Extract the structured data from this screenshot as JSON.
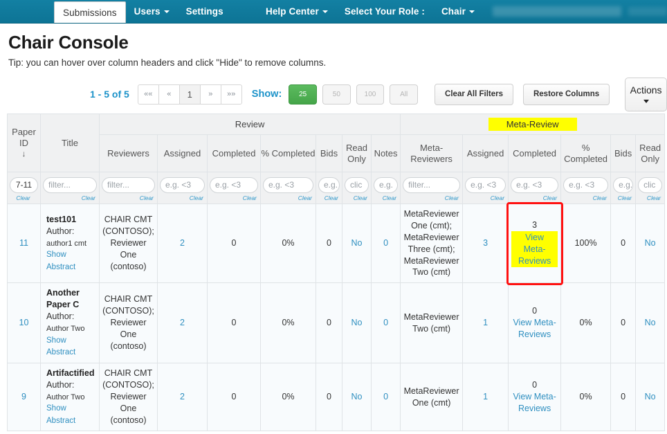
{
  "navbar": {
    "items": [
      {
        "label": "Submissions",
        "active": true,
        "caret": false
      },
      {
        "label": "Users",
        "active": false,
        "caret": true
      },
      {
        "label": "Settings",
        "active": false,
        "caret": false
      }
    ],
    "right_items": [
      {
        "label": "Help Center",
        "caret": true
      },
      {
        "label": "Select Your Role :",
        "caret": false
      },
      {
        "label": "Chair",
        "caret": true
      }
    ]
  },
  "page": {
    "title": "Chair Console",
    "tip": "Tip: you can hover over column headers and click \"Hide\" to remove columns."
  },
  "toolbar": {
    "result_count": "1 - 5 of 5",
    "pager": [
      "««",
      "«",
      "1",
      "»",
      "»»"
    ],
    "current_page": "1",
    "show_label": "Show:",
    "page_sizes": [
      "25",
      "50",
      "100",
      "All"
    ],
    "active_page_size": "25",
    "clear_all_filters": "Clear All Filters",
    "restore_columns": "Restore Columns",
    "actions": "Actions"
  },
  "table": {
    "group_headers": [
      {
        "label": "Review",
        "highlight": false
      },
      {
        "label": "Meta-Review",
        "highlight": true
      }
    ],
    "columns": [
      {
        "key": "paper_id",
        "label": "Paper ID",
        "sort": "↓",
        "filter": "7-11",
        "filter_type": "value"
      },
      {
        "key": "title",
        "label": "Title",
        "filter": "filter...",
        "filter_type": "placeholder"
      },
      {
        "key": "reviewers",
        "label": "Reviewers",
        "filter": "filter...",
        "filter_type": "placeholder"
      },
      {
        "key": "assigned",
        "label": "Assigned",
        "filter": "e.g. <3",
        "filter_type": "placeholder"
      },
      {
        "key": "completed",
        "label": "Completed",
        "filter": "e.g. <3",
        "filter_type": "placeholder"
      },
      {
        "key": "pct_completed",
        "label": "% Completed",
        "filter": "e.g. <3",
        "filter_type": "placeholder"
      },
      {
        "key": "bids",
        "label": "Bids",
        "filter": "e.g.",
        "filter_type": "placeholder"
      },
      {
        "key": "read_only",
        "label": "Read Only",
        "filter": "clic",
        "filter_type": "placeholder"
      },
      {
        "key": "notes",
        "label": "Notes",
        "filter": "e.g.",
        "filter_type": "placeholder"
      },
      {
        "key": "meta_reviewers",
        "label": "Meta-Reviewers",
        "filter": "filter...",
        "filter_type": "placeholder"
      },
      {
        "key": "m_assigned",
        "label": "Assigned",
        "filter": "e.g. <3",
        "filter_type": "placeholder"
      },
      {
        "key": "m_completed",
        "label": "Completed",
        "filter": "e.g. <3",
        "filter_type": "placeholder"
      },
      {
        "key": "m_pct_completed",
        "label": "% Completed",
        "filter": "e.g. <3",
        "filter_type": "placeholder"
      },
      {
        "key": "m_bids",
        "label": "Bids",
        "filter": "e.g.",
        "filter_type": "placeholder"
      },
      {
        "key": "m_read_only",
        "label": "Read Only",
        "filter": "clic",
        "filter_type": "placeholder"
      }
    ],
    "clear_label": "Clear",
    "view_meta_reviews_label": "View Meta-Reviews",
    "show_abstract_label": "Show Abstract",
    "author_label": "Author:",
    "rows": [
      {
        "paper_id": "11",
        "title": "test101",
        "author": "author1 cmt",
        "reviewers": "CHAIR CMT (CONTOSO); Reviewer One (contoso)",
        "assigned": "2",
        "completed": "0",
        "pct_completed": "0%",
        "bids": "0",
        "read_only": "No",
        "notes": "0",
        "meta_reviewers": "MetaReviewer One (cmt); MetaReviewer Three (cmt); MetaReviewer Two (cmt)",
        "m_assigned": "3",
        "m_completed": "3",
        "m_completed_highlight": true,
        "m_pct_completed": "100%",
        "m_bids": "0",
        "m_read_only": "No",
        "annotated": true
      },
      {
        "paper_id": "10",
        "title": "Another Paper C",
        "author": "Author Two",
        "reviewers": "CHAIR CMT (CONTOSO); Reviewer One (contoso)",
        "assigned": "2",
        "completed": "0",
        "pct_completed": "0%",
        "bids": "0",
        "read_only": "No",
        "notes": "0",
        "meta_reviewers": "MetaReviewer Two (cmt)",
        "m_assigned": "1",
        "m_completed": "0",
        "m_completed_highlight": false,
        "m_pct_completed": "0%",
        "m_bids": "0",
        "m_read_only": "No",
        "annotated": false
      },
      {
        "paper_id": "9",
        "title": "Artifactified",
        "author": "Author Two",
        "reviewers": "CHAIR CMT (CONTOSO); Reviewer One (contoso)",
        "assigned": "2",
        "completed": "0",
        "pct_completed": "0%",
        "bids": "0",
        "read_only": "No",
        "notes": "0",
        "meta_reviewers": "MetaReviewer One (cmt)",
        "m_assigned": "1",
        "m_completed": "0",
        "m_completed_highlight": false,
        "m_pct_completed": "0%",
        "m_bids": "0",
        "m_read_only": "No",
        "annotated": false
      }
    ]
  },
  "colors": {
    "navbar": "#0e7c9e",
    "accent_link": "#2f8fc0",
    "highlight": "#ffff00",
    "annotation": "#ff1111",
    "active_green": "#4cb050"
  }
}
